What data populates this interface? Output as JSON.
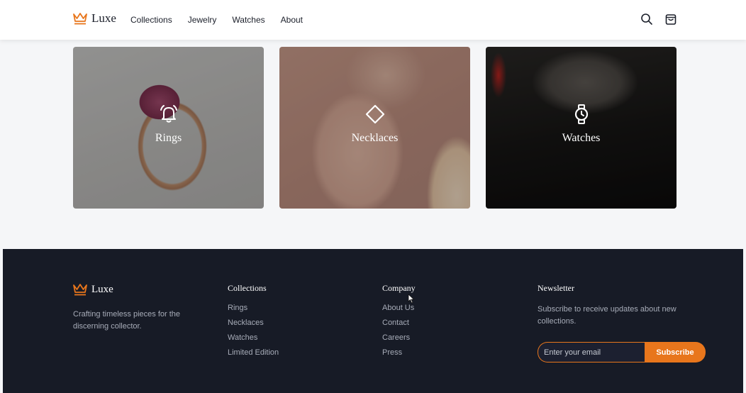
{
  "brand": {
    "name": "Luxe",
    "logo_icon": "crown-icon",
    "accent": "#e8761c"
  },
  "header": {
    "nav": [
      "Collections",
      "Jewelry",
      "Watches",
      "About"
    ],
    "icons": [
      "search-icon",
      "shopping-bag-icon"
    ]
  },
  "categories": [
    {
      "label": "Rings",
      "icon": "bell-icon"
    },
    {
      "label": "Necklaces",
      "icon": "diamond-icon"
    },
    {
      "label": "Watches",
      "icon": "watch-icon"
    }
  ],
  "footer": {
    "tagline": "Crafting timeless pieces for the discerning collector.",
    "collections": {
      "title": "Collections",
      "links": [
        "Rings",
        "Necklaces",
        "Watches",
        "Limited Edition"
      ]
    },
    "company": {
      "title": "Company",
      "links": [
        "About Us",
        "Contact",
        "Careers",
        "Press"
      ]
    },
    "newsletter": {
      "title": "Newsletter",
      "description": "Subscribe to receive updates about new collections.",
      "placeholder": "Enter your email",
      "button": "Subscribe"
    },
    "background": "#171b26"
  }
}
